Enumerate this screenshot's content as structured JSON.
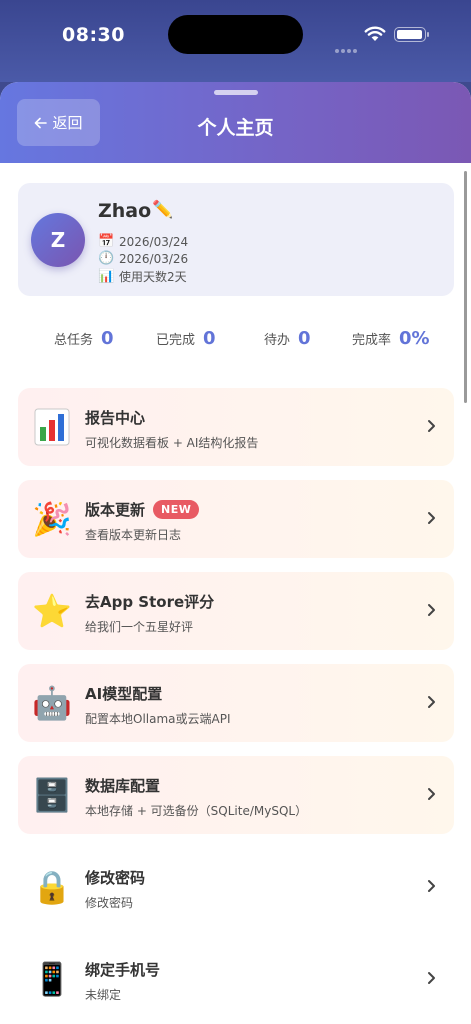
{
  "status_bar": {
    "time": "08:30"
  },
  "header": {
    "back_label": "返回",
    "title": "个人主页"
  },
  "profile": {
    "avatar_letter": "Z",
    "name": "Zhao",
    "register_date": "2026/03/24",
    "last_login_date": "2026/03/26",
    "usage_days": "使用天数2天"
  },
  "stats": [
    {
      "label": "总任务",
      "value": "0"
    },
    {
      "label": "已完成",
      "value": "0"
    },
    {
      "label": "待办",
      "value": "0"
    },
    {
      "label": "完成率",
      "value": "0%"
    }
  ],
  "menu": [
    {
      "title": "报告中心",
      "subtitle": "可视化数据看板 + AI结构化报告",
      "icon": "bar-chart-icon"
    },
    {
      "title": "版本更新",
      "badge": "NEW",
      "subtitle": "查看版本更新日志",
      "icon": "party-popper-icon",
      "glyph": "🎉"
    },
    {
      "title": "去App Store评分",
      "subtitle": "给我们一个五星好评",
      "icon": "star-icon",
      "glyph": "⭐"
    },
    {
      "title": "AI模型配置",
      "subtitle": "配置本地Ollama或云端API",
      "icon": "robot-icon",
      "glyph": "🤖"
    },
    {
      "title": "数据库配置",
      "subtitle": "本地存储 + 可选备份（SQLite/MySQL）",
      "icon": "file-cabinet-icon",
      "glyph": "🗄️"
    },
    {
      "title": "修改密码",
      "subtitle": "修改密码",
      "icon": "lock-icon",
      "glyph": "🔒"
    },
    {
      "title": "绑定手机号",
      "subtitle": "未绑定",
      "icon": "mobile-phone-icon",
      "glyph": "📱"
    }
  ],
  "colors": {
    "accent": "#6274d8",
    "header_start": "#6677e0",
    "header_end": "#7b58b4",
    "badge": "#e85a63"
  }
}
